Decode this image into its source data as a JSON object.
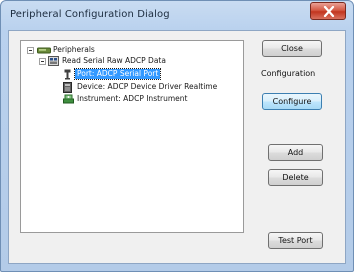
{
  "window": {
    "title": "Peripheral Configuration Dialog"
  },
  "tree": {
    "root": {
      "label": "Peripherals",
      "icon": "peripherals-folder-icon",
      "expanded": true
    },
    "group": {
      "label": "Read Serial Raw ADCP Data",
      "icon": "data-group-icon",
      "expanded": true
    },
    "children": [
      {
        "label": "Port: ADCP Serial Port",
        "icon": "serial-port-icon",
        "selected": true
      },
      {
        "label": "Device: ADCP Device Driver Realtime",
        "icon": "device-driver-icon",
        "selected": false
      },
      {
        "label": "Instrument: ADCP Instrument",
        "icon": "instrument-icon",
        "selected": false
      }
    ]
  },
  "buttons": {
    "close": "Close",
    "configure": "Configure",
    "add": "Add",
    "delete": "Delete",
    "test_port": "Test Port"
  },
  "configuration_label": "Configuration",
  "colors": {
    "selection": "#3399ff",
    "titlebar": "#b9d1ee",
    "close_button": "#c2351f"
  }
}
